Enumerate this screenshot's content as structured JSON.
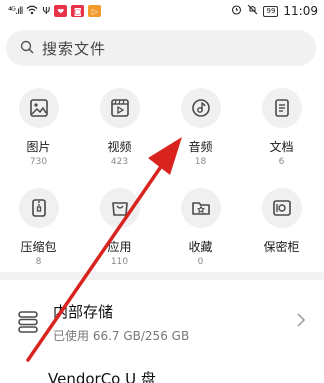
{
  "status_bar": {
    "carrier_signal": "⁴ᴳ.ıll",
    "battery": "99",
    "time": "11:09"
  },
  "search": {
    "placeholder": "搜索文件"
  },
  "categories": [
    {
      "label": "图片",
      "count": "730",
      "icon": "image-icon"
    },
    {
      "label": "视频",
      "count": "423",
      "icon": "video-icon"
    },
    {
      "label": "音频",
      "count": "18",
      "icon": "audio-icon"
    },
    {
      "label": "文档",
      "count": "6",
      "icon": "document-icon"
    },
    {
      "label": "压缩包",
      "count": "8",
      "icon": "archive-icon"
    },
    {
      "label": "应用",
      "count": "110",
      "icon": "app-bag-icon"
    },
    {
      "label": "收藏",
      "count": "0",
      "icon": "favorites-folder-icon"
    },
    {
      "label": "保密柜",
      "count": "",
      "icon": "safe-icon"
    }
  ],
  "storage": {
    "internal": {
      "title": "内部存储",
      "usage": "已使用 66.7 GB/256 GB"
    },
    "usb": {
      "title": "VendorCo U 盘"
    }
  },
  "colors": {
    "annotation_arrow": "#d9231e",
    "icon_gray": "#4a4a4a",
    "circle_bg": "#f0f0f0"
  }
}
